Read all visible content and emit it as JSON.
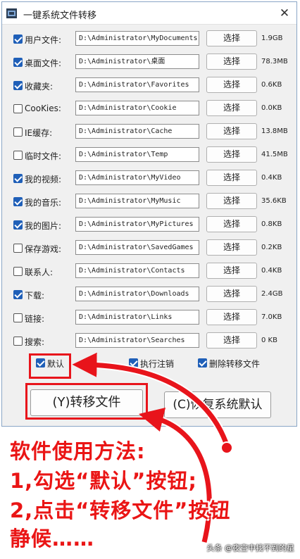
{
  "window": {
    "title": "一键系统文件转移",
    "close_glyph": "✕"
  },
  "rows": [
    {
      "label": "用户文件:",
      "checked": true,
      "path": "D:\\Administrator\\MyDocuments",
      "button": "选择",
      "size": "1.9GB"
    },
    {
      "label": "桌面文件:",
      "checked": true,
      "path": "D:\\Administrator\\桌面",
      "button": "选择",
      "size": "78.3MB"
    },
    {
      "label": "收藏夹:",
      "checked": true,
      "path": "D:\\Administrator\\Favorites",
      "button": "选择",
      "size": "0.6KB"
    },
    {
      "label": "CooKies:",
      "checked": false,
      "path": "D:\\Administrator\\Cookie",
      "button": "选择",
      "size": "0.0KB"
    },
    {
      "label": "IE缓存:",
      "checked": false,
      "path": "D:\\Administrator\\Cache",
      "button": "选择",
      "size": "13.8MB"
    },
    {
      "label": "临时文件:",
      "checked": false,
      "path": "D:\\Administrator\\Temp",
      "button": "选择",
      "size": "41.5MB"
    },
    {
      "label": "我的视频:",
      "checked": true,
      "path": "D:\\Administrator\\MyVideo",
      "button": "选择",
      "size": "0.4KB"
    },
    {
      "label": "我的音乐:",
      "checked": true,
      "path": "D:\\Administrator\\MyMusic",
      "button": "选择",
      "size": "35.6KB"
    },
    {
      "label": "我的图片:",
      "checked": true,
      "path": "D:\\Administrator\\MyPictures",
      "button": "选择",
      "size": "0.8KB"
    },
    {
      "label": "保存游戏:",
      "checked": false,
      "path": "D:\\Administrator\\SavedGames",
      "button": "选择",
      "size": "0.2KB"
    },
    {
      "label": "联系人:",
      "checked": false,
      "path": "D:\\Administrator\\Contacts",
      "button": "选择",
      "size": "0.4KB"
    },
    {
      "label": "下载:",
      "checked": true,
      "path": "D:\\Administrator\\Downloads",
      "button": "选择",
      "size": "2.4GB"
    },
    {
      "label": "链接:",
      "checked": false,
      "path": "D:\\Administrator\\Links",
      "button": "选择",
      "size": "7.0KB"
    },
    {
      "label": "搜索:",
      "checked": false,
      "path": "D:\\Administrator\\Searches",
      "button": "选择",
      "size": "0 KB"
    }
  ],
  "options": {
    "default": {
      "label": "默认",
      "checked": true
    },
    "logoff": {
      "label": "执行注销",
      "checked": true
    },
    "delete": {
      "label": "删除转移文件",
      "checked": true
    }
  },
  "buttons": {
    "transfer": "(Y)转移文件",
    "restore": "(C)恢复系统默认"
  },
  "instructions": {
    "line1": "软件使用方法:",
    "line2": "1,勾选“默认”按钮;",
    "line3": "2,点击“转移文件”按钮",
    "line4": "静候……"
  },
  "watermark": "头条 @夜空中找不到的星",
  "colors": {
    "annotation_red": "#e8141b",
    "checkbox_blue": "#1f5fb8"
  }
}
